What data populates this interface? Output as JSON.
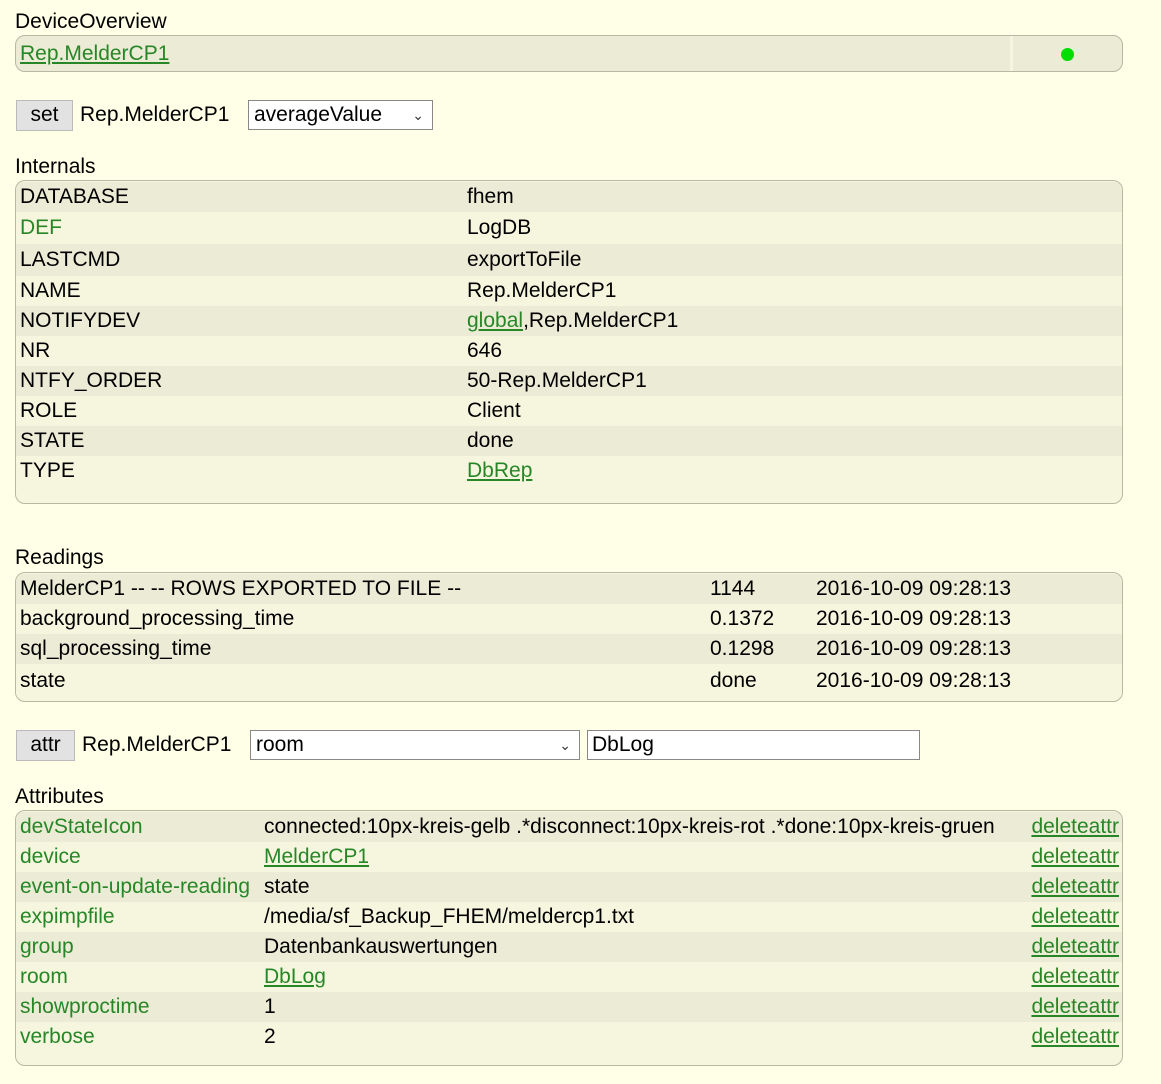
{
  "overview": {
    "title": "DeviceOverview",
    "device_link": "Rep.MelderCP1",
    "state_color": "#00dd00"
  },
  "set_row": {
    "button": "set",
    "device": "Rep.MelderCP1",
    "selected": "averageValue"
  },
  "internals": {
    "title": "Internals",
    "rows": [
      {
        "key": "DATABASE",
        "value": "fhem"
      },
      {
        "key": "DEF",
        "value": "LogDB"
      },
      {
        "key": "LASTCMD",
        "value": "exportToFile"
      },
      {
        "key": "NAME",
        "value": "Rep.MelderCP1"
      },
      {
        "key": "NOTIFYDEV",
        "link": "global",
        "value": ",Rep.MelderCP1"
      },
      {
        "key": "NR",
        "value": "646"
      },
      {
        "key": "NTFY_ORDER",
        "value": "50-Rep.MelderCP1"
      },
      {
        "key": "ROLE",
        "value": "Client"
      },
      {
        "key": "STATE",
        "value": "done"
      },
      {
        "key": "TYPE",
        "link": "DbRep"
      }
    ]
  },
  "readings": {
    "title": "Readings",
    "rows": [
      {
        "name": "MelderCP1 -- -- ROWS EXPORTED TO FILE --",
        "value": "1144",
        "time": "2016-10-09 09:28:13"
      },
      {
        "name": "background_processing_time",
        "value": "0.1372",
        "time": "2016-10-09 09:28:13"
      },
      {
        "name": "sql_processing_time",
        "value": "0.1298",
        "time": "2016-10-09 09:28:13"
      },
      {
        "name": "state",
        "value": "done",
        "time": "2016-10-09 09:28:13"
      }
    ]
  },
  "attr_row": {
    "button": "attr",
    "device": "Rep.MelderCP1",
    "selected": "room",
    "input_value": "DbLog"
  },
  "attributes": {
    "title": "Attributes",
    "delete_label": "deleteattr",
    "rows": [
      {
        "name": "devStateIcon",
        "value": "connected:10px-kreis-gelb .*disconnect:10px-kreis-rot .*done:10px-kreis-gruen"
      },
      {
        "name": "device",
        "link": "MelderCP1"
      },
      {
        "name": "event-on-update-reading",
        "value": "state"
      },
      {
        "name": "expimpfile",
        "value": "/media/sf_Backup_FHEM/meldercp1.txt"
      },
      {
        "name": "group",
        "value": "Datenbankauswertungen"
      },
      {
        "name": "room",
        "link": "DbLog"
      },
      {
        "name": "showproctime",
        "value": "1"
      },
      {
        "name": "verbose",
        "value": "2"
      }
    ]
  }
}
